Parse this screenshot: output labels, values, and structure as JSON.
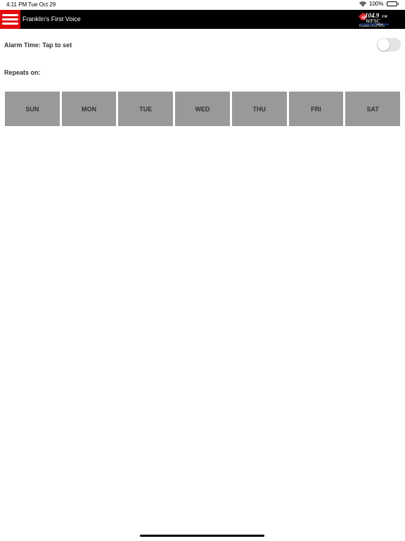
{
  "status_bar": {
    "time": "4:11 PM",
    "date": "Tue Oct 29",
    "battery": "100%",
    "battery_level": 1.0,
    "icons": [
      "wifi-icon",
      "battery-icon"
    ]
  },
  "header": {
    "title": "Franklin's First Voice",
    "menu_icon": "hamburger-menu-icon",
    "logo": {
      "frequency": "104.9",
      "band": "FM",
      "call_letters": "WFSC",
      "am_frequency": "1050AM",
      "tagline": "Franklin's First Voice"
    }
  },
  "alarm": {
    "label": "Alarm Time: Tap to set",
    "enabled": false
  },
  "repeats": {
    "label": "Repeats on:",
    "days": [
      "SUN",
      "MON",
      "TUE",
      "WED",
      "THU",
      "FRI",
      "SAT"
    ]
  },
  "colors": {
    "header_background": "#000000",
    "menu_button": "#e10d0d",
    "day_button": "#999999",
    "toggle_off": "#e4e4e4",
    "logo_red": "#d4202a",
    "logo_blue": "#1a3b8c"
  }
}
